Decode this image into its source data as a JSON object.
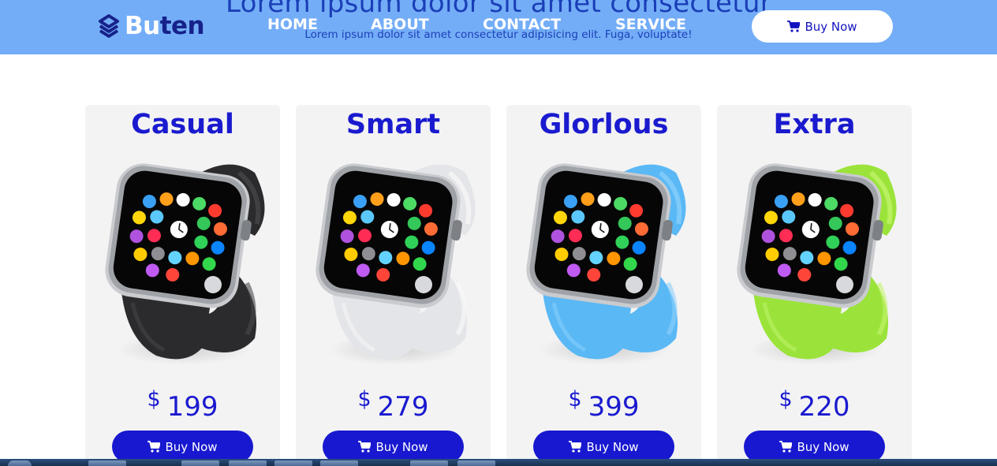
{
  "hero": {
    "title": "Lorem ipsum dolor sit amet consectetur",
    "subtitle": "Lorem ipsum dolor sit amet consectetur adipisicing elit. Fuga, voluptate!"
  },
  "brand": {
    "name_first": "Bu",
    "name_rest": "ten"
  },
  "nav": {
    "links": [
      "HOME",
      "ABOUT",
      "CONTACT",
      "SERVICE"
    ],
    "buy_label": "Buy Now"
  },
  "products": [
    {
      "name": "Casual",
      "currency": "$",
      "price": "199",
      "buy_label": "Buy Now",
      "band_color": "#2b2b2d",
      "band_light": "#4a4a4d"
    },
    {
      "name": "Smart",
      "currency": "$",
      "price": "279",
      "buy_label": "Buy Now",
      "band_color": "#e4e5e8",
      "band_light": "#fafafa"
    },
    {
      "name": "Glorlous",
      "currency": "$",
      "price": "399",
      "buy_label": "Buy Now",
      "band_color": "#5ab8f5",
      "band_light": "#8dd1fb"
    },
    {
      "name": "Extra",
      "currency": "$",
      "price": "220",
      "buy_label": "Buy Now",
      "band_color": "#9be33a",
      "band_light": "#c4f56f"
    }
  ],
  "colors": {
    "navbar_bg": "#74adf7",
    "accent": "#1818d0",
    "title_text": "#1a1acf",
    "card_bg": "#f3f3f3"
  },
  "icons": {
    "cart": "shopping-cart-icon",
    "logo": "layers-logo-icon"
  }
}
